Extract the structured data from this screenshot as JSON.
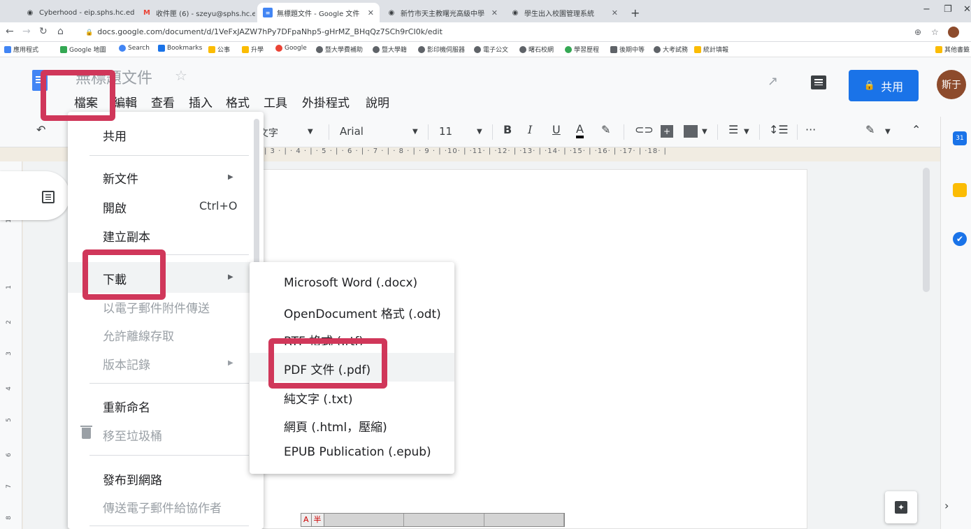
{
  "browser": {
    "tabs": [
      {
        "title": "Cyberhood - eip.sphs.hc.edu.tw",
        "left": 0
      },
      {
        "title": "收件匣 (6) - szeyu@sphs.hc.edu",
        "left": 0
      },
      {
        "title": "無標題文件 - Google 文件",
        "left": 0
      },
      {
        "title": "新竹市天主教曙光高級中學",
        "left": 0
      },
      {
        "title": "學生出入校園管理系統",
        "left": 0
      }
    ],
    "new_tab": "+",
    "url": "docs.google.com/document/d/1VeFxJAZW7hPy7DFpaNhp5-gHrMZ_BHqQz7SCh9rCI0k/edit",
    "bookmarks": [
      {
        "label": "應用程式",
        "color": "#4285f4"
      },
      {
        "label": "Google 地圖",
        "color": "#34a853"
      },
      {
        "label": "Search",
        "color": "#4285f4"
      },
      {
        "label": "Bookmarks",
        "color": "#1a73e8"
      },
      {
        "label": "公事",
        "color": "#fbbc04"
      },
      {
        "label": "升學",
        "color": "#fbbc04"
      },
      {
        "label": "Google",
        "color": "#ea4335"
      },
      {
        "label": "暨大學費補助",
        "color": "#5f6368"
      },
      {
        "label": "暨大學籍",
        "color": "#5f6368"
      },
      {
        "label": "影印機伺服器",
        "color": "#5f6368"
      },
      {
        "label": "電子公文",
        "color": "#5f6368"
      },
      {
        "label": "曙石校網",
        "color": "#5f6368"
      },
      {
        "label": "學習歷程",
        "color": "#34a853"
      },
      {
        "label": "後期中等",
        "color": "#5f6368"
      },
      {
        "label": "大考試務",
        "color": "#5f6368"
      },
      {
        "label": "統計填報",
        "color": "#fbbc04"
      }
    ],
    "other_bookmarks": "其他書籤"
  },
  "docs": {
    "title": "無標題文件",
    "menus": [
      "檔案",
      "編輯",
      "查看",
      "插入",
      "格式",
      "工具",
      "外掛程式",
      "說明"
    ],
    "share_label": "共用",
    "avatar_text": "斯于",
    "toolbar": {
      "style": "文字",
      "font": "Arial",
      "size": "11",
      "bold": "B",
      "italic": "I",
      "underline": "U",
      "text_color": "A",
      "more": "···"
    },
    "ruler": "| 3 · | · 4 · | · 5 · | · 6 · | · 7 · | · 8 · | · 9 · | ·10· | ·11· | ·12· | ·13· | ·14· | ·15· | ·16· | ·17· | ·18· |",
    "vruler_numbers": [
      "2",
      "1",
      "1",
      "2",
      "3",
      "4",
      "5",
      "6",
      "7",
      "8"
    ]
  },
  "file_menu": {
    "share": "共用",
    "new": "新文件",
    "open": "開啟",
    "open_shortcut": "Ctrl+O",
    "copy": "建立副本",
    "download": "下載",
    "email": "以電子郵件附件傳送",
    "offline": "允許離線存取",
    "history": "版本記錄",
    "rename": "重新命名",
    "trash": "移至垃圾桶",
    "publish": "發布到網路",
    "email_collab": "傳送電子郵件給協作者"
  },
  "download_menu": [
    "Microsoft Word (.docx)",
    "OpenDocument 格式 (.odt)",
    "RTF 格式 (.rtf)",
    "PDF 文件 (.pdf)",
    "純文字 (.txt)",
    "網頁 (.html，壓縮)",
    "EPUB Publication (.epub)"
  ],
  "ime": {
    "a": "A",
    "half": "半"
  },
  "colors": {
    "annotation": "#d0375a",
    "accent": "#1a73e8"
  }
}
